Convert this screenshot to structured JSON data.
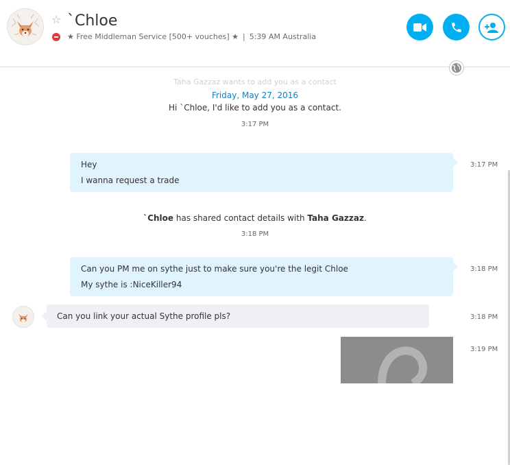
{
  "header": {
    "name": "`Chloe",
    "mood": "★ Free Middleman Service [500+ vouches] ★",
    "separator": "|",
    "local_time": "5:39 AM Australia",
    "status_color": "#e0383e",
    "accent_color": "#00aff0",
    "buttons": [
      {
        "icon": "video-camera-icon"
      },
      {
        "icon": "phone-icon"
      },
      {
        "icon": "add-contact-icon"
      }
    ]
  },
  "chat": {
    "faded_top_text": "Taha Gazzaz wants to add you as a contact",
    "date_divider": "Friday, May 27, 2016",
    "contact_request": {
      "text": "Hi `Chloe, I'd like to add you as a contact.",
      "time": "3:17 PM"
    },
    "messages": [
      {
        "direction": "outgoing",
        "lines": [
          "Hey",
          "I wanna request a trade"
        ],
        "time": "3:17 PM"
      },
      {
        "direction": "outgoing",
        "lines": [
          "Can you PM me on sythe just to make sure you're the legit Chloe",
          "My sythe is :NiceKiller94"
        ],
        "time": "3:18 PM"
      },
      {
        "direction": "incoming",
        "lines": [
          "Can you link your actual Sythe profile pls?"
        ],
        "time": "3:18 PM"
      },
      {
        "direction": "outgoing",
        "type": "image",
        "time": "3:19 PM"
      }
    ],
    "shared_contact": {
      "sender": "`Chloe",
      "middle": " has shared contact details with ",
      "recipient": "Taha Gazzaz",
      "end": ".",
      "time": "3:18 PM"
    }
  }
}
